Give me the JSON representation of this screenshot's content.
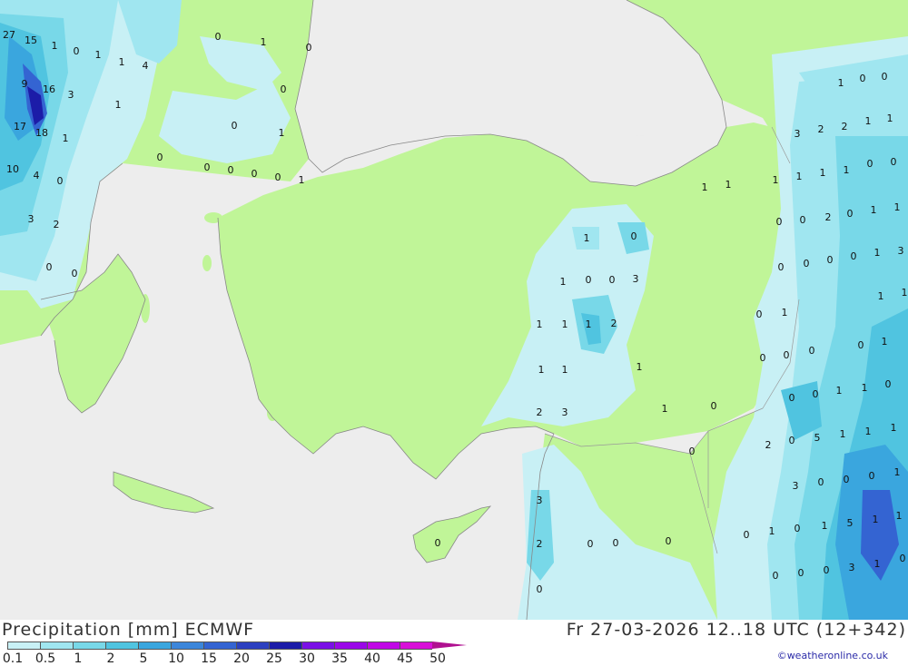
{
  "header": {
    "title": "Precipitation [mm] ECMWF",
    "datetime": "Fr 27-03-2026 12..18 UTC (12+342)"
  },
  "legend": {
    "ticks": [
      "0.1",
      "0.5",
      "1",
      "2",
      "5",
      "10",
      "15",
      "20",
      "25",
      "30",
      "35",
      "40",
      "45",
      "50"
    ],
    "colors": [
      "#c8f0f5",
      "#a0e6f0",
      "#78d8e8",
      "#50c4e0",
      "#3aa6de",
      "#3c86da",
      "#3464d2",
      "#2c40c0",
      "#1c1ca8",
      "#7a10e6",
      "#9a08e8",
      "#c008e6",
      "#d810d8",
      "#b01090"
    ]
  },
  "credit": "©weatheronline.co.uk",
  "map_colors": {
    "sea": "#ededed",
    "land": "#c0f598",
    "rain_light": "#c8f0f5",
    "rain_low": "#a0e6f0",
    "rain_mid": "#78d8e8",
    "rain_mod": "#50c4e0",
    "rain_heavy": "#3aa6de",
    "rain_vheavy": "#3464d2",
    "rain_extreme": "#1c1ca8"
  },
  "values": [
    "27",
    "15",
    "1",
    "0",
    "1",
    "1",
    "4",
    "0",
    "1",
    "0",
    "9",
    "16",
    "3",
    "1",
    "0",
    "17",
    "18",
    "1",
    "0",
    "1",
    "10",
    "4",
    "0",
    "0",
    "0",
    "0",
    "0",
    "0",
    "1",
    "3",
    "2",
    "0",
    "0",
    "0",
    "1",
    "0",
    "2",
    "2",
    "1",
    "1",
    "3",
    "0",
    "0",
    "1",
    "1",
    "1",
    "1",
    "1",
    "1",
    "2",
    "0",
    "0",
    "0",
    "1",
    "1",
    "0",
    "0",
    "0",
    "0",
    "1",
    "3",
    "1",
    "0",
    "1",
    "0",
    "0",
    "3",
    "1",
    "1",
    "1",
    "2",
    "1",
    "1",
    "1",
    "0",
    "1",
    "0",
    "0",
    "0",
    "0",
    "1",
    "1",
    "1",
    "0",
    "0",
    "1",
    "1",
    "0",
    "2",
    "3",
    "1",
    "0",
    "0",
    "2",
    "0",
    "5",
    "1",
    "1",
    "1",
    "3",
    "0",
    "0",
    "0",
    "1",
    "1",
    "5",
    "1",
    "1",
    "3",
    "2",
    "0",
    "0",
    "0",
    "0",
    "1",
    "0",
    "0",
    "0",
    "0",
    "3",
    "1",
    "0",
    "0",
    "0"
  ]
}
